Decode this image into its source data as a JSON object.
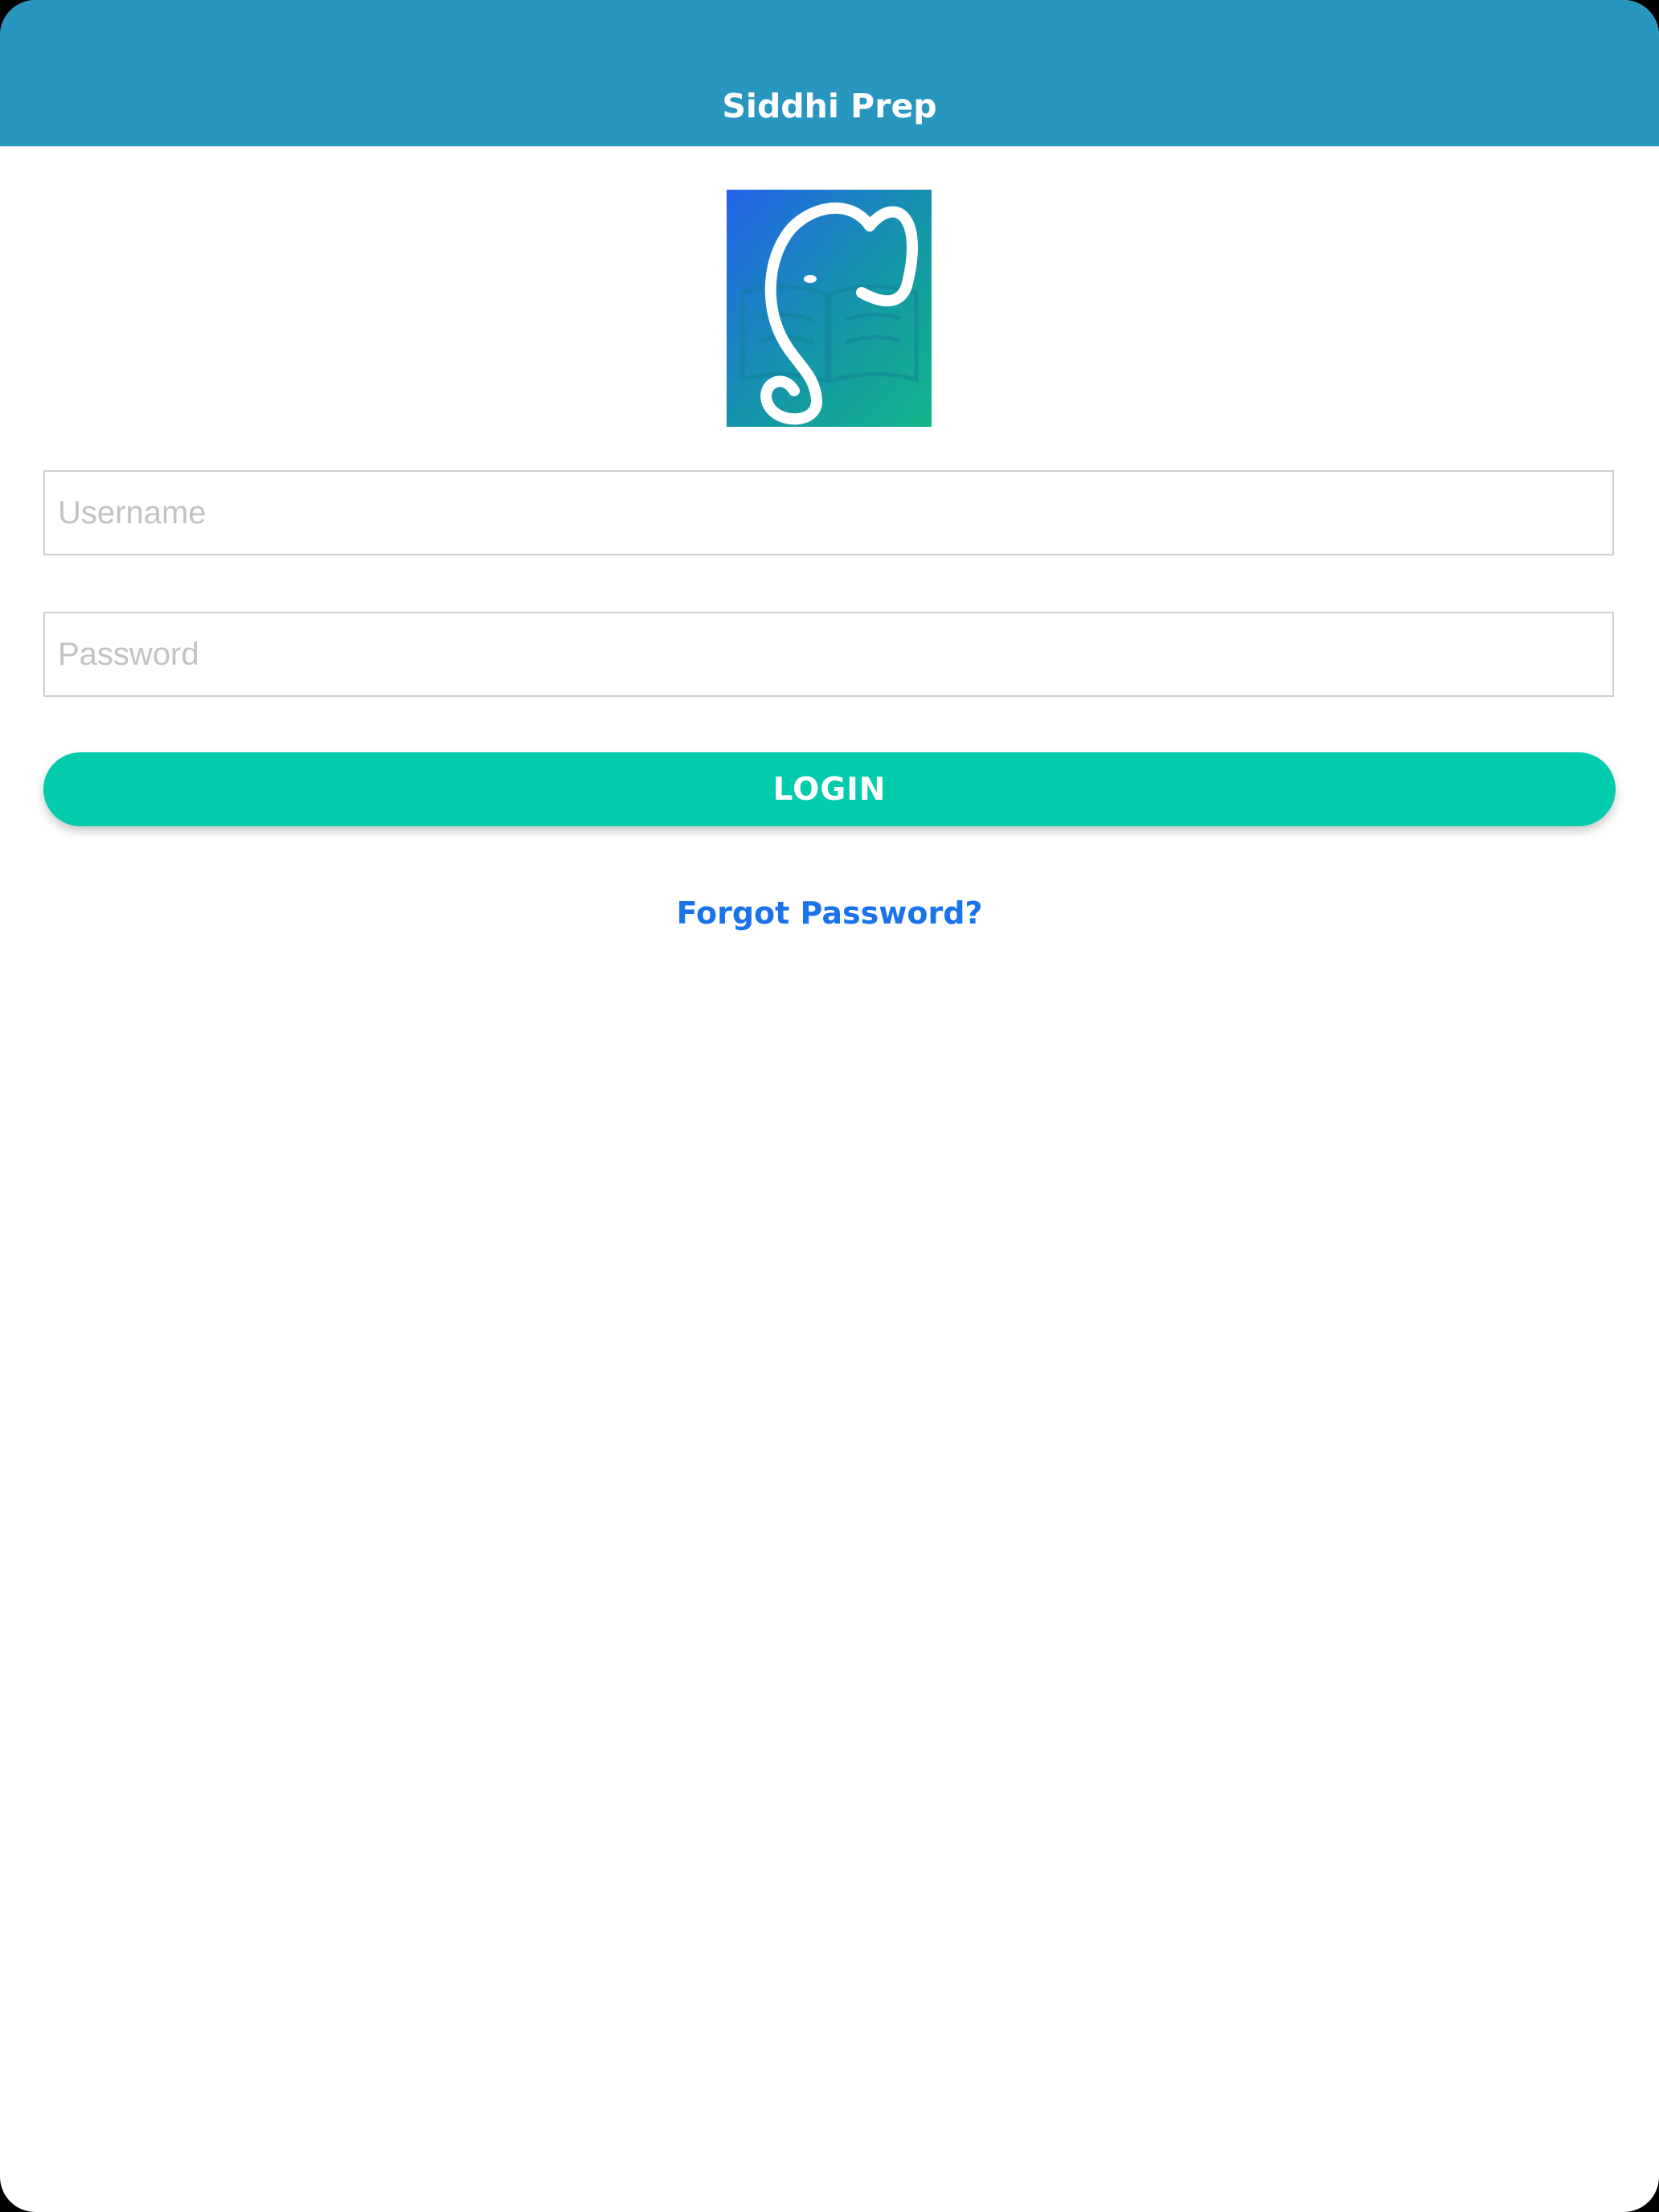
{
  "header": {
    "title": "Siddhi Prep",
    "background_color": "#2896bf"
  },
  "logo": {
    "icon": "elephant-book-logo-icon",
    "gradient_colors": [
      "#2563eb",
      "#13b58a"
    ]
  },
  "form": {
    "username_placeholder": "Username",
    "username_value": "",
    "password_placeholder": "Password",
    "password_value": ""
  },
  "actions": {
    "login_label": "LOGIN",
    "login_color": "#02ccab",
    "forgot_password_label": "Forgot Password?",
    "forgot_password_color": "#1a73e8"
  }
}
